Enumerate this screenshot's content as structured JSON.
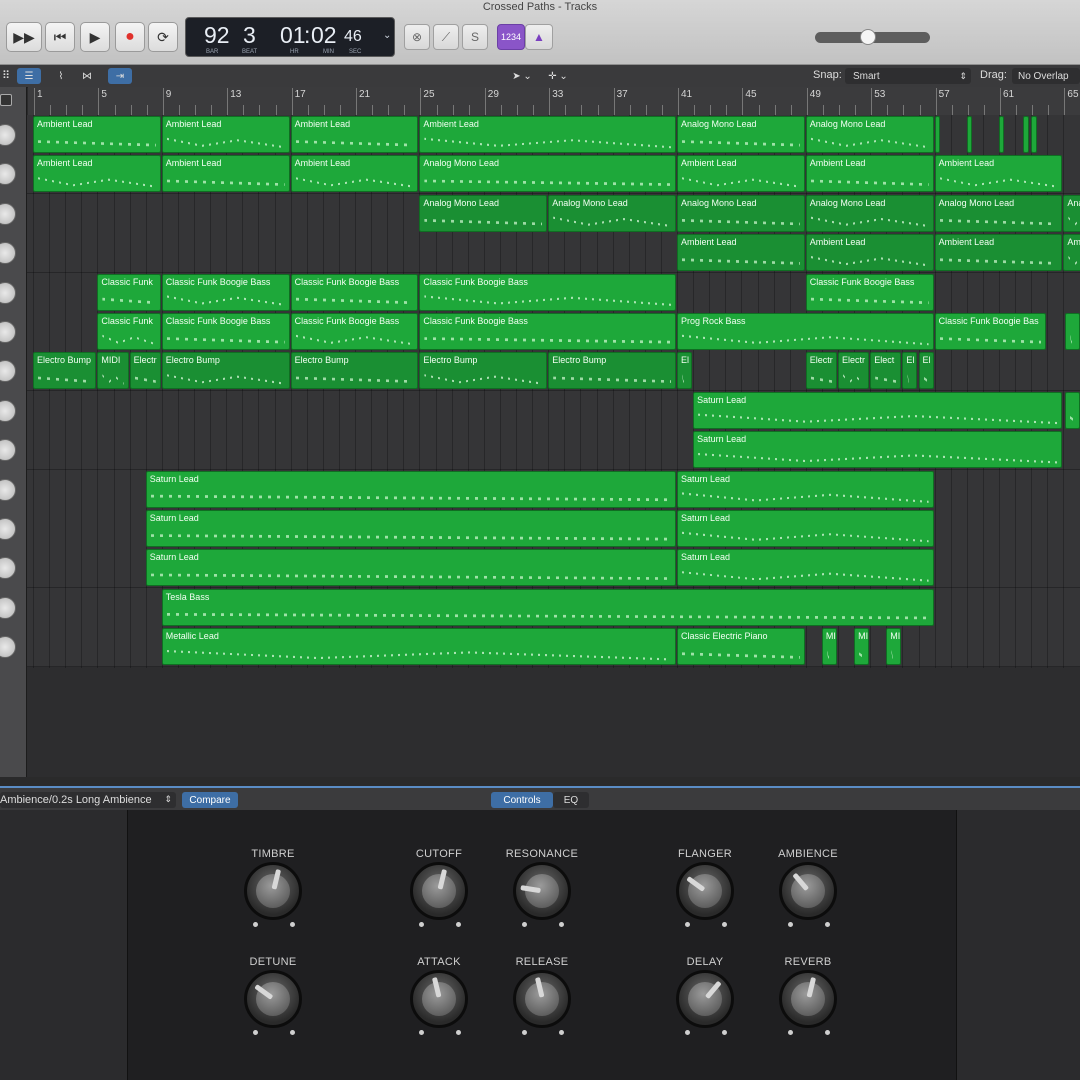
{
  "window": {
    "title": "Crossed Paths - Tracks"
  },
  "transport": {
    "fast_forward": "▶▶",
    "rewind": "⏮",
    "play": "▶",
    "record": "●",
    "cycle": "⟳",
    "lcd": {
      "bar": "92",
      "beat": "3",
      "hr": "01",
      "min_sec": "02",
      "sec": "46",
      "bar_label": "BAR",
      "beat_label": "BEAT",
      "hr_label": "HR",
      "min_label": "MIN",
      "sec_label": "SEC"
    },
    "count_in": "1234",
    "solo_label": "S",
    "master_volume": 0.45
  },
  "tracks_toolbar": {
    "snap_label": "Snap:",
    "snap_value": "Smart",
    "drag_label": "Drag:",
    "drag_value": "No Overlap"
  },
  "ruler": {
    "bars": [
      "1",
      "5",
      "9",
      "13",
      "17",
      "21",
      "25",
      "29",
      "33",
      "37",
      "41",
      "45",
      "49",
      "53",
      "57",
      "61",
      "65"
    ]
  },
  "regions": [
    {
      "lane": 0,
      "bar": 1,
      "len": 8,
      "name": "Ambient Lead"
    },
    {
      "lane": 0,
      "bar": 9,
      "len": 8,
      "name": "Ambient Lead"
    },
    {
      "lane": 0,
      "bar": 17,
      "len": 8,
      "name": "Ambient Lead"
    },
    {
      "lane": 0,
      "bar": 25,
      "len": 16,
      "name": "Ambient Lead"
    },
    {
      "lane": 0,
      "bar": 41,
      "len": 8,
      "name": "Analog Mono Lead"
    },
    {
      "lane": 0,
      "bar": 49,
      "len": 8,
      "name": "Analog Mono Lead"
    },
    {
      "lane": 0,
      "bar": 57,
      "len": 0.4,
      "name": ""
    },
    {
      "lane": 0,
      "bar": 59,
      "len": 0.4,
      "name": ""
    },
    {
      "lane": 0,
      "bar": 61,
      "len": 0.4,
      "name": ""
    },
    {
      "lane": 0,
      "bar": 62.5,
      "len": 0.4,
      "name": ""
    },
    {
      "lane": 0,
      "bar": 63,
      "len": 0.4,
      "name": ""
    },
    {
      "lane": 1,
      "bar": 1,
      "len": 8,
      "name": "Ambient Lead"
    },
    {
      "lane": 1,
      "bar": 9,
      "len": 8,
      "name": "Ambient Lead"
    },
    {
      "lane": 1,
      "bar": 17,
      "len": 8,
      "name": "Ambient Lead"
    },
    {
      "lane": 1,
      "bar": 25,
      "len": 16,
      "name": "Analog Mono Lead"
    },
    {
      "lane": 1,
      "bar": 41,
      "len": 8,
      "name": "Ambient Lead"
    },
    {
      "lane": 1,
      "bar": 49,
      "len": 8,
      "name": "Ambient Lead"
    },
    {
      "lane": 1,
      "bar": 57,
      "len": 8,
      "name": "Ambient Lead"
    },
    {
      "lane": 2,
      "bar": 25,
      "len": 8,
      "name": "Analog Mono Lead",
      "dark": true
    },
    {
      "lane": 2,
      "bar": 33,
      "len": 8,
      "name": "Analog Mono Lead",
      "dark": true
    },
    {
      "lane": 2,
      "bar": 41,
      "len": 8,
      "name": "Analog Mono Lead",
      "dark": true
    },
    {
      "lane": 2,
      "bar": 49,
      "len": 8,
      "name": "Analog Mono Lead",
      "dark": true
    },
    {
      "lane": 2,
      "bar": 57,
      "len": 8,
      "name": "Analog Mono Lead",
      "dark": true
    },
    {
      "lane": 2,
      "bar": 65,
      "len": 2,
      "name": "Ana",
      "dark": true
    },
    {
      "lane": 3,
      "bar": 41,
      "len": 8,
      "name": "Ambient Lead",
      "dark": true
    },
    {
      "lane": 3,
      "bar": 49,
      "len": 8,
      "name": "Ambient Lead",
      "dark": true
    },
    {
      "lane": 3,
      "bar": 57,
      "len": 8,
      "name": "Ambient Lead",
      "dark": true
    },
    {
      "lane": 3,
      "bar": 65,
      "len": 2,
      "name": "Amb",
      "dark": true
    },
    {
      "lane": 4,
      "bar": 5,
      "len": 4,
      "name": "Classic Funk"
    },
    {
      "lane": 4,
      "bar": 9,
      "len": 8,
      "name": "Classic Funk Boogie Bass"
    },
    {
      "lane": 4,
      "bar": 17,
      "len": 8,
      "name": "Classic Funk Boogie Bass"
    },
    {
      "lane": 4,
      "bar": 25,
      "len": 16,
      "name": "Classic Funk Boogie Bass"
    },
    {
      "lane": 4,
      "bar": 49,
      "len": 8,
      "name": "Classic Funk Boogie Bass"
    },
    {
      "lane": 5,
      "bar": 5,
      "len": 4,
      "name": "Classic Funk"
    },
    {
      "lane": 5,
      "bar": 9,
      "len": 8,
      "name": "Classic Funk Boogie Bass"
    },
    {
      "lane": 5,
      "bar": 17,
      "len": 8,
      "name": "Classic Funk Boogie Bass"
    },
    {
      "lane": 5,
      "bar": 25,
      "len": 16,
      "name": "Classic Funk Boogie Bass"
    },
    {
      "lane": 5,
      "bar": 41,
      "len": 16,
      "name": "Prog Rock Bass"
    },
    {
      "lane": 5,
      "bar": 57,
      "len": 7,
      "name": "Classic Funk Boogie Bas"
    },
    {
      "lane": 5,
      "bar": 65.1,
      "len": 1,
      "name": ""
    },
    {
      "lane": 6,
      "bar": 1,
      "len": 4,
      "name": "Electro Bump",
      "dark": true
    },
    {
      "lane": 6,
      "bar": 5,
      "len": 2,
      "name": "MIDI",
      "dark": true
    },
    {
      "lane": 6,
      "bar": 7,
      "len": 2,
      "name": "Electr",
      "dark": true
    },
    {
      "lane": 6,
      "bar": 9,
      "len": 8,
      "name": "Electro Bump",
      "dark": true
    },
    {
      "lane": 6,
      "bar": 17,
      "len": 8,
      "name": "Electro Bump",
      "dark": true
    },
    {
      "lane": 6,
      "bar": 25,
      "len": 8,
      "name": "Electro Bump",
      "dark": true
    },
    {
      "lane": 6,
      "bar": 33,
      "len": 8,
      "name": "Electro Bump",
      "dark": true
    },
    {
      "lane": 6,
      "bar": 41,
      "len": 1,
      "name": "El",
      "dark": true
    },
    {
      "lane": 6,
      "bar": 49,
      "len": 2,
      "name": "Electr",
      "dark": true
    },
    {
      "lane": 6,
      "bar": 51,
      "len": 2,
      "name": "Electr",
      "dark": true
    },
    {
      "lane": 6,
      "bar": 53,
      "len": 2,
      "name": "Elect",
      "dark": true
    },
    {
      "lane": 6,
      "bar": 55,
      "len": 1,
      "name": "El",
      "dark": true
    },
    {
      "lane": 6,
      "bar": 56,
      "len": 1,
      "name": "El",
      "dark": true
    },
    {
      "lane": 7,
      "bar": 42,
      "len": 23,
      "name": "Saturn Lead"
    },
    {
      "lane": 7,
      "bar": 65.1,
      "len": 1,
      "name": ""
    },
    {
      "lane": 8,
      "bar": 42,
      "len": 23,
      "name": "Saturn Lead"
    },
    {
      "lane": 9,
      "bar": 8,
      "len": 33,
      "name": "Saturn Lead"
    },
    {
      "lane": 9,
      "bar": 41,
      "len": 16,
      "name": "Saturn Lead"
    },
    {
      "lane": 10,
      "bar": 8,
      "len": 33,
      "name": "Saturn Lead"
    },
    {
      "lane": 10,
      "bar": 41,
      "len": 16,
      "name": "Saturn Lead"
    },
    {
      "lane": 11,
      "bar": 8,
      "len": 33,
      "name": "Saturn Lead"
    },
    {
      "lane": 11,
      "bar": 41,
      "len": 16,
      "name": "Saturn Lead"
    },
    {
      "lane": 12,
      "bar": 9,
      "len": 48,
      "name": "Tesla Bass"
    },
    {
      "lane": 13,
      "bar": 9,
      "len": 32,
      "name": "Metallic Lead"
    },
    {
      "lane": 13,
      "bar": 41,
      "len": 8,
      "name": "Classic Electric Piano"
    },
    {
      "lane": 13,
      "bar": 50,
      "len": 1,
      "name": "MI"
    },
    {
      "lane": 13,
      "bar": 52,
      "len": 1,
      "name": "MI"
    },
    {
      "lane": 13,
      "bar": 54,
      "len": 1,
      "name": "MI"
    }
  ],
  "plugin_bar": {
    "preset": "Ambience/0.2s Long Ambience",
    "compare": "Compare",
    "tab_controls": "Controls",
    "tab_eq": "EQ"
  },
  "synth_controls": [
    {
      "label": "TIMBRE",
      "value": 0.55
    },
    {
      "label": "CUTOFF",
      "value": 0.55
    },
    {
      "label": "RESONANCE",
      "value": 0.2
    },
    {
      "label": "FLANGER",
      "value": 0.3
    },
    {
      "label": "AMBIENCE",
      "value": 0.35
    },
    {
      "label": "DETUNE",
      "value": 0.3
    },
    {
      "label": "ATTACK",
      "value": 0.45
    },
    {
      "label": "RELEASE",
      "value": 0.45
    },
    {
      "label": "DELAY",
      "value": 0.65
    },
    {
      "label": "REVERB",
      "value": 0.55
    }
  ]
}
